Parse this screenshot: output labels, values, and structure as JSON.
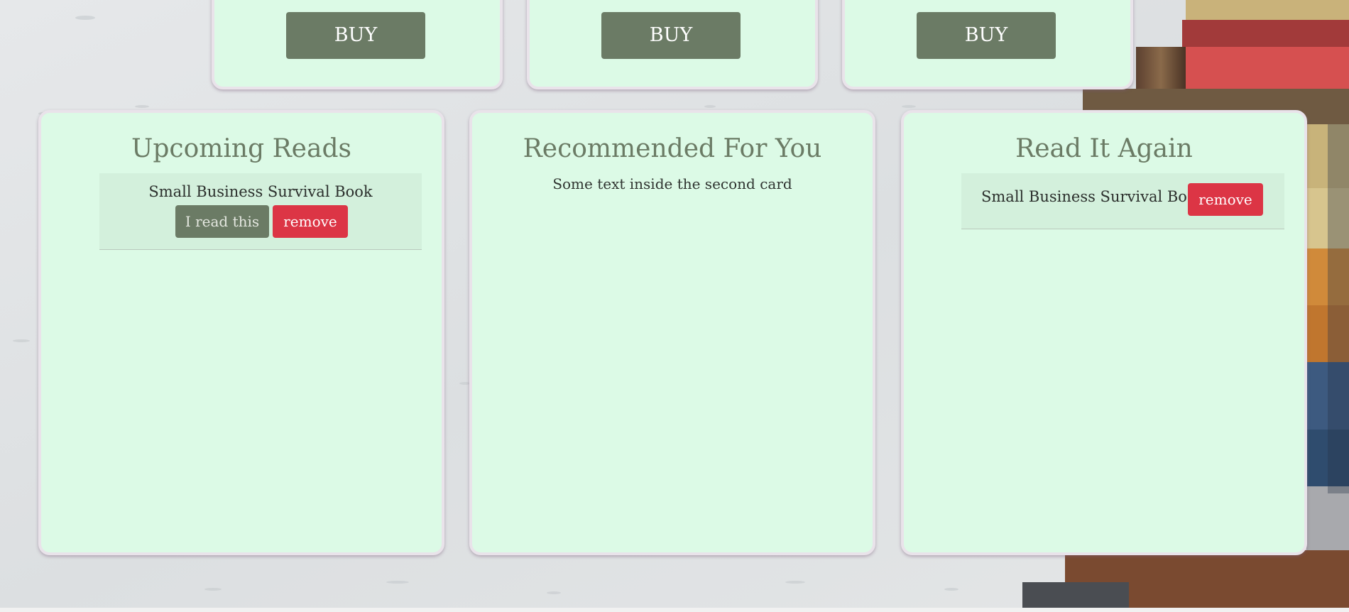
{
  "shop": {
    "buy_buttons": [
      {
        "label": "BUY"
      },
      {
        "label": "BUY"
      },
      {
        "label": "BUY"
      }
    ]
  },
  "cards": {
    "upcoming": {
      "title": "Upcoming Reads",
      "items": [
        {
          "book": "Small Business Survival Book",
          "read_label": "I read this",
          "remove_label": "remove"
        }
      ]
    },
    "recommended": {
      "title": "Recommended For You",
      "text": "Some text inside the second card"
    },
    "read_again": {
      "title": "Read It Again",
      "items": [
        {
          "book": "Small Business Survival Book",
          "remove_label": "remove"
        }
      ]
    }
  },
  "colors": {
    "card_bg": "#dcfae6",
    "primary_button": "#6b7b65",
    "danger_button": "#dc3545",
    "title_text": "#6b7b65"
  }
}
